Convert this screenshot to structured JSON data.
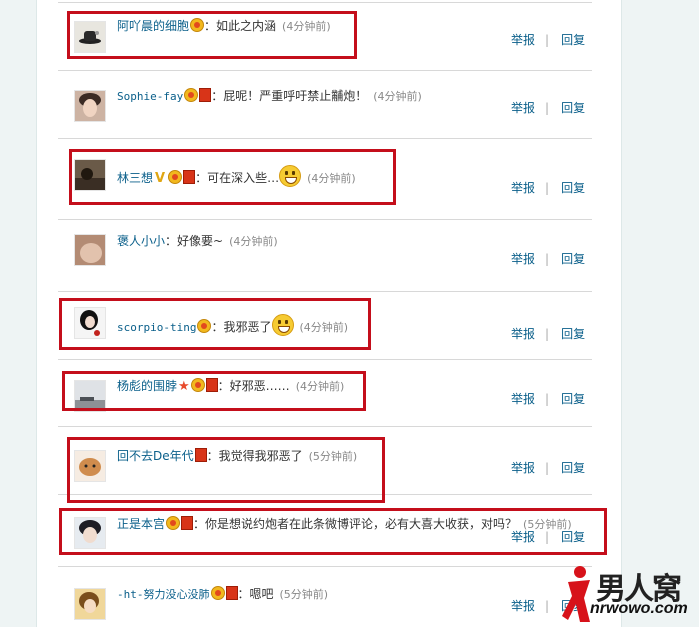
{
  "actions": {
    "report": "举报",
    "separator": "|",
    "reply": "回复"
  },
  "comments": [
    {
      "user": "阿吖晨的细胞",
      "text": "：如此之内涵",
      "time": "(4分钟前)"
    },
    {
      "user": "Sophie-fay",
      "text": "：屁呢！严重呼吁禁止黼炮！",
      "time": "(4分钟前)"
    },
    {
      "user": "林三想",
      "text": "：可在深入些…",
      "time": "(4分钟前)"
    },
    {
      "user": "褒人小小",
      "text": "：好像要~",
      "time": "(4分钟前)"
    },
    {
      "user": "scorpio-ting",
      "text": "：我邪恶了",
      "time": "(4分钟前)"
    },
    {
      "user": "杨彪的围脖",
      "text": "：好邪恶……",
      "time": "(4分钟前)"
    },
    {
      "user": "回不去De年代",
      "text": "：我觉得我邪恶了",
      "time": "(5分钟前)"
    },
    {
      "user": "正是本宫",
      "text": "：你是想说约炮者在此条微博评论，必有大喜大收获，对吗？",
      "time": "(5分钟前)"
    },
    {
      "user": "-ht-努力没心没肺",
      "text": "：嗯吧",
      "time": "(5分钟前)"
    }
  ],
  "watermark": {
    "brand": "男人窝",
    "url": "nrwowo.com"
  },
  "colors": {
    "highlight": "#c40e1b",
    "link": "#0a5f8a"
  }
}
